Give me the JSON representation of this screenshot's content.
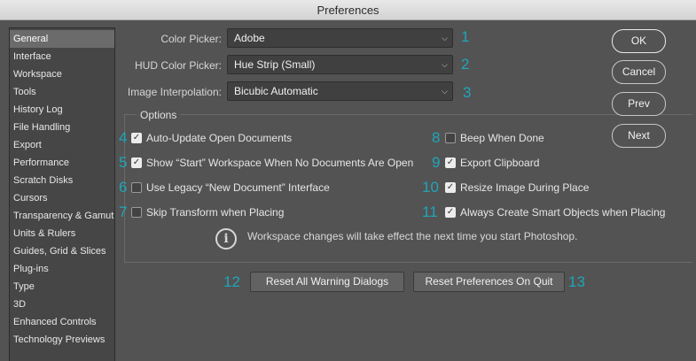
{
  "window": {
    "title": "Preferences"
  },
  "sidebar": {
    "items": [
      {
        "label": "General",
        "active": true
      },
      {
        "label": "Interface"
      },
      {
        "label": "Workspace"
      },
      {
        "label": "Tools"
      },
      {
        "label": "History Log"
      },
      {
        "label": "File Handling"
      },
      {
        "label": "Export"
      },
      {
        "label": "Performance"
      },
      {
        "label": "Scratch Disks"
      },
      {
        "label": "Cursors"
      },
      {
        "label": "Transparency & Gamut"
      },
      {
        "label": "Units & Rulers"
      },
      {
        "label": "Guides, Grid & Slices"
      },
      {
        "label": "Plug-ins"
      },
      {
        "label": "Type"
      },
      {
        "label": "3D"
      },
      {
        "label": "Enhanced Controls"
      },
      {
        "label": "Technology Previews"
      }
    ]
  },
  "fields": {
    "color_picker": {
      "label": "Color Picker:",
      "value": "Adobe",
      "marker": "1"
    },
    "hud_color_picker": {
      "label": "HUD Color Picker:",
      "value": "Hue Strip (Small)",
      "marker": "2"
    },
    "image_interpolation": {
      "label": "Image Interpolation:",
      "value": "Bicubic Automatic",
      "marker": "3"
    }
  },
  "options": {
    "title": "Options",
    "left": [
      {
        "label": "Auto-Update Open Documents",
        "checked": true,
        "marker": "4"
      },
      {
        "label": "Show “Start” Workspace When No Documents Are Open",
        "checked": true,
        "marker": "5"
      },
      {
        "label": "Use Legacy “New Document” Interface",
        "checked": false,
        "marker": "6"
      },
      {
        "label": "Skip Transform when Placing",
        "checked": false,
        "marker": "7"
      }
    ],
    "right": [
      {
        "label": "Beep When Done",
        "checked": false,
        "marker": "8"
      },
      {
        "label": "Export Clipboard",
        "checked": true,
        "marker": "9"
      },
      {
        "label": "Resize Image During Place",
        "checked": true,
        "marker": "10"
      },
      {
        "label": "Always Create Smart Objects when Placing",
        "checked": true,
        "marker": "11"
      }
    ],
    "info": "Workspace changes will take effect the next time you start Photoshop.",
    "info_icon_glyph": "i"
  },
  "reset": {
    "warning_dialogs": {
      "label": "Reset All Warning Dialogs",
      "marker": "12"
    },
    "preferences_on_quit": {
      "label": "Reset Preferences On Quit",
      "marker": "13"
    }
  },
  "buttons": {
    "ok": "OK",
    "cancel": "Cancel",
    "prev": "Prev",
    "next": "Next"
  },
  "colors": {
    "annotation": "#1fa5ba",
    "background": "#535353",
    "sidebar": "#464646",
    "sidebar_active": "#6b6b6b"
  }
}
